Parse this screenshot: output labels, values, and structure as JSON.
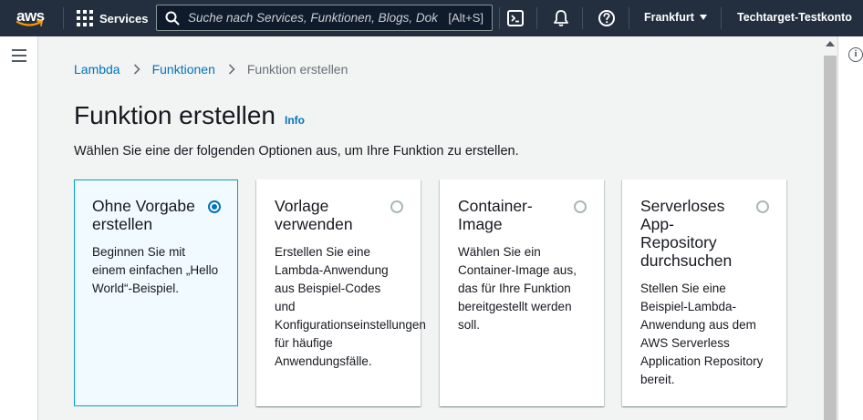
{
  "topbar": {
    "logo_text": "aws",
    "services_label": "Services",
    "search_placeholder": "Suche nach Services, Funktionen, Blogs, Dok",
    "search_shortcut": "[Alt+S]",
    "region": "Frankfurt",
    "account": "Techtarget-Testkonto",
    "icons": [
      "cloudshell-icon",
      "bell-icon",
      "help-icon"
    ]
  },
  "breadcrumb": {
    "items": [
      "Lambda",
      "Funktionen",
      "Funktion erstellen"
    ]
  },
  "page": {
    "title": "Funktion erstellen",
    "info_link": "Info",
    "description": "Wählen Sie eine der folgenden Optionen aus, um Ihre Funktion zu erstellen."
  },
  "options": [
    {
      "title": "Ohne Vorgabe erstellen",
      "description": "Beginnen Sie mit einem einfachen „Hello World“-Beispiel.",
      "selected": true
    },
    {
      "title": "Vorlage verwenden",
      "description": "Erstellen Sie eine Lambda-Anwendung aus Beispiel-Codes und Konfigurationseinstellungen für häufige Anwendungsfälle.",
      "selected": false
    },
    {
      "title": "Container-Image",
      "description": "Wählen Sie ein Container-Image aus, das für Ihre Funktion bereitgestellt werden soll.",
      "selected": false
    },
    {
      "title": "Serverloses App-Repository durchsuchen",
      "description": "Stellen Sie eine Beispiel-Lambda-Anwendung aus dem AWS Serverless Application Repository bereit.",
      "selected": false
    }
  ],
  "colors": {
    "nav_bg": "#232f3e",
    "link": "#0073bb",
    "selected_border": "#00a1c9",
    "selected_bg": "#f1faff",
    "page_bg": "#f2f3f3"
  }
}
